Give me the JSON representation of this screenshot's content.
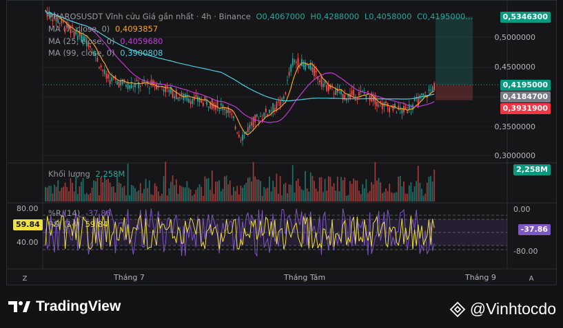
{
  "legend": {
    "symbol": "PHAROSUSDT Vĩnh cửu Giá gần nhất · 4h · Binance",
    "open": "O0,4067000",
    "high": "H0,4288000",
    "low": "L0,4058000",
    "close": "C0,4195000...",
    "ma7_label": "MA (7, close, 0)",
    "ma7_value": "0,4093857",
    "ma25_label": "MA (25, close, 0)",
    "ma25_value": "0,4059680",
    "ma99_label": "MA (99, close, 0)",
    "ma99_value": "0,3900808",
    "volume_label": "Khối lượng",
    "volume_value": "2,258M",
    "wr_label": "%R (14)",
    "wr_value": "-37.86",
    "rsi_label": "RSI (14)",
    "rsi_value": "59.84"
  },
  "price_axis": [
    "0,5000000",
    "0,4500000",
    "0,3500000",
    "0,3000000"
  ],
  "price_tags": {
    "target": "0,5346300",
    "last": "0,4195000",
    "entry": "0,4184700",
    "stop": "0,3931900",
    "volume": "2,258M",
    "wr": "-37.86",
    "rsi": "59.84"
  },
  "osc_axis": {
    "left_top": "80.00",
    "left_mid": "40.00",
    "right_top": "0.00",
    "right_bottom": "-80.00"
  },
  "time_axis": [
    "Tháng 7",
    "Tháng Tám",
    "Tháng 9"
  ],
  "buttons": {
    "z": "Z",
    "a": "A"
  },
  "footer": {
    "brand": "TradingView",
    "author": "@Vinhtocdo"
  },
  "colors": {
    "up": "#26a69a",
    "down": "#ef5350",
    "ma7": "#f7a325",
    "ma25": "#c13bd6",
    "ma99": "#4dd0e1",
    "rsi": "#f0e040",
    "wr": "#7e57c2"
  }
}
